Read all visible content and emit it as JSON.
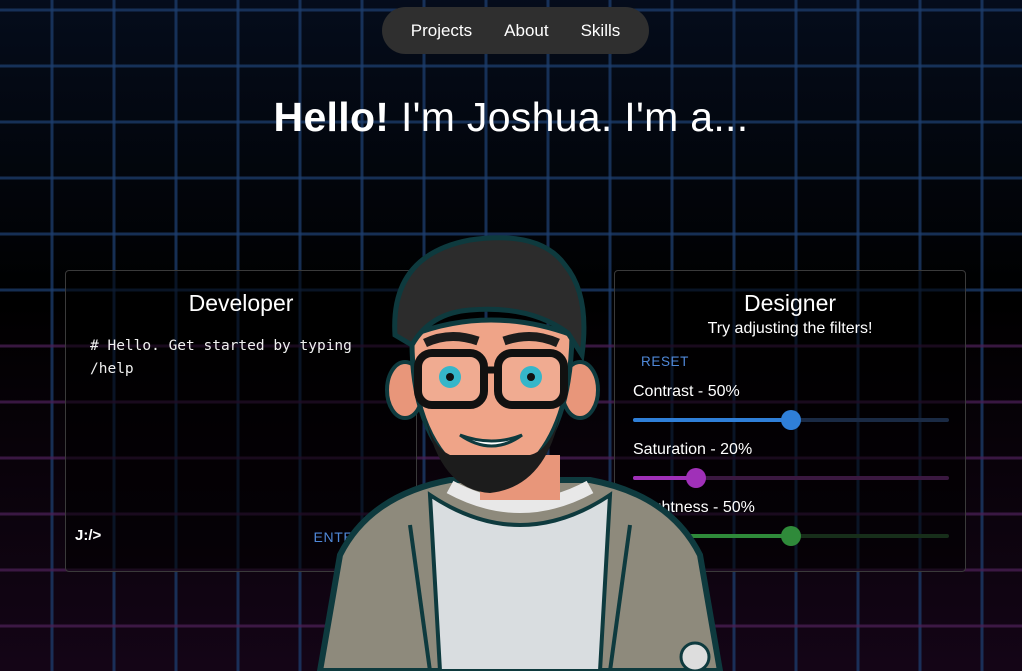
{
  "nav": {
    "items": [
      {
        "label": "Projects"
      },
      {
        "label": "About"
      },
      {
        "label": "Skills"
      }
    ]
  },
  "hero": {
    "greeting_bold": "Hello!",
    "greeting_rest": " I'm Joshua. I'm a..."
  },
  "developer": {
    "title": "Developer",
    "terminal_text": "# Hello. Get started by typing /help",
    "prompt": "J:/>",
    "enter_label": "ENTER"
  },
  "designer": {
    "title": "Designer",
    "subtitle": "Try adjusting the filters!",
    "reset_label": "RESET",
    "sliders": [
      {
        "label": "Contrast - 50%",
        "value": 0.5,
        "color": "#2f7fd8",
        "track": "#1a2a44"
      },
      {
        "label": "Saturation - 20%",
        "value": 0.2,
        "color": "#a030b8",
        "track": "#3a1840"
      },
      {
        "label": "Brightness - 50%",
        "value": 0.5,
        "color": "#2f8a3a",
        "track": "#172e1a"
      }
    ]
  },
  "colors": {
    "accent_blue": "#4f88d8",
    "nav_bg": "#2f2f2f"
  }
}
